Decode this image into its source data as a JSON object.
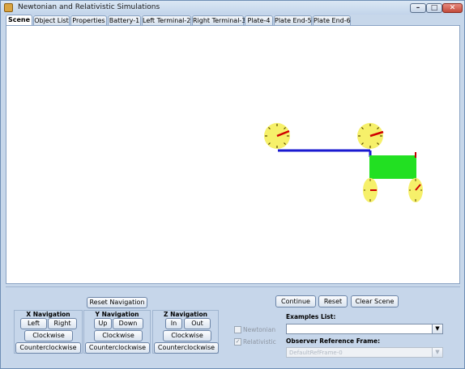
{
  "window": {
    "title": "Newtonian and Relativistic Simulations",
    "buttons": [
      "–",
      "□",
      "✕"
    ]
  },
  "tabs": [
    "Scene",
    "Object List",
    "Properties",
    "Battery-1",
    "Left Terminal-2",
    "Right Terminal-3",
    "Plate-4",
    "Plate End-5",
    "Plate End-6"
  ],
  "active_tab": "Scene",
  "scene_colors": {
    "clock_face": "#f6f06a",
    "clock_hand": "#d00000",
    "wire": "#1a1ad0",
    "plate": "#22e022",
    "background": "#ffffff"
  },
  "navigation": {
    "reset": "Reset Navigation",
    "x": {
      "title": "X Navigation",
      "left": "Left",
      "right": "Right",
      "cw": "Clockwise",
      "ccw": "Counterclockwise"
    },
    "y": {
      "title": "Y Navigation",
      "up": "Up",
      "down": "Down",
      "cw": "Clockwise",
      "ccw": "Counterclockwise"
    },
    "z": {
      "title": "Z Navigation",
      "in": "In",
      "out": "Out",
      "cw": "Clockwise",
      "ccw": "Counterclockwise"
    }
  },
  "controls": {
    "continue": "Continue",
    "reset": "Reset",
    "clear_scene": "Clear Scene",
    "newtonian": "Newtonian",
    "relativistic": "Relativistic",
    "examples_label": "Examples List:",
    "examples_value": "",
    "frame_label": "Observer Reference Frame:",
    "frame_value": "DefaultRefFrame-0"
  }
}
